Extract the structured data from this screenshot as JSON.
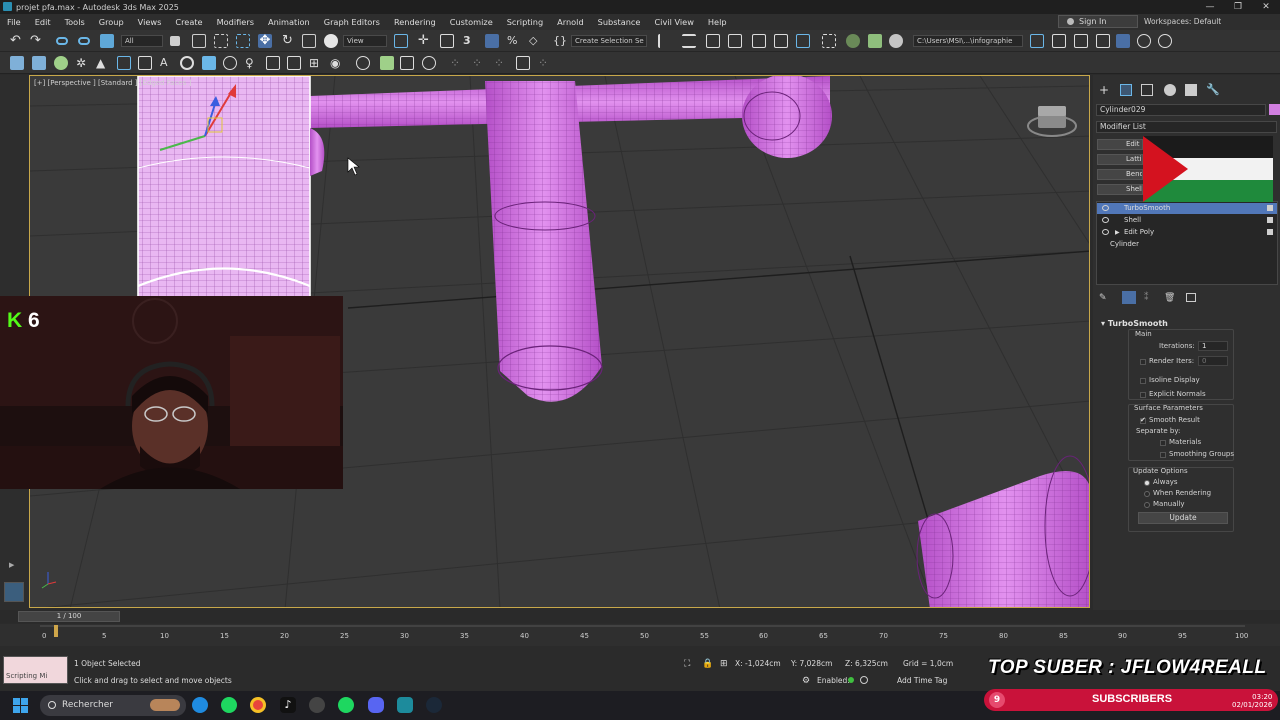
{
  "window": {
    "title": "projet pfa.max - Autodesk 3ds Max 2025",
    "controls": [
      "—",
      "❐",
      "✕"
    ]
  },
  "menubar": {
    "items": [
      "File",
      "Edit",
      "Tools",
      "Group",
      "Views",
      "Create",
      "Modifiers",
      "Animation",
      "Graph Editors",
      "Rendering",
      "Customize",
      "Scripting",
      "Arnold",
      "Substance",
      "Civil View",
      "Help"
    ],
    "sign_in": "Sign In",
    "workspaces": "Workspaces: Default"
  },
  "toolbar": {
    "selection_filter": "All",
    "ref_coord": "View",
    "named_selection": "Create Selection Se",
    "project_path": "C:\\Users\\MSI\\...\\infographie"
  },
  "viewport": {
    "label": "[+] [Perspective ] [Standard ] [Edged Faces ]"
  },
  "command_panel": {
    "object_name": "Cylinder029",
    "object_color": "#d17fe0",
    "modifier_list": "Modifier List",
    "modifier_buttons": [
      "Edit Poly",
      "Lattice",
      "Bend",
      "Shell"
    ],
    "stack": [
      {
        "label": "TurboSmooth",
        "selected": true
      },
      {
        "label": "Shell",
        "selected": false
      },
      {
        "label": "Edit Poly",
        "selected": false
      },
      {
        "label": "Cylinder",
        "selected": false
      }
    ],
    "turbosmooth": {
      "title": "TurboSmooth",
      "main": "Main",
      "iterations_label": "Iterations:",
      "iterations": "1",
      "render_iters_label": "Render Iters:",
      "render_iters": "0",
      "isoline": "Isoline Display",
      "explicit_normals": "Explicit Normals",
      "surface_params": "Surface Parameters",
      "smooth_result": "Smooth Result",
      "separate_by": "Separate by:",
      "materials": "Materials",
      "smoothing_groups": "Smoothing Groups",
      "update_options": "Update Options",
      "always": "Always",
      "when_rendering": "When Rendering",
      "manually": "Manually",
      "update": "Update"
    }
  },
  "timeline": {
    "slider": "1 / 100",
    "ticks": [
      "0",
      "5",
      "10",
      "15",
      "20",
      "25",
      "30",
      "35",
      "40",
      "45",
      "50",
      "55",
      "60",
      "65",
      "70",
      "75",
      "80",
      "85",
      "90",
      "95",
      "100"
    ]
  },
  "status": {
    "maxscript_label": "Scripting Mi",
    "selected": "1 Object Selected",
    "prompt": "Click and drag to select and move objects",
    "x": "X: -1,024cm",
    "y": "Y: 7,028cm",
    "z": "Z: 6,325cm",
    "grid": "Grid = 1,0cm",
    "enabled": "Enabled:",
    "add_time_tag": "Add Time Tag"
  },
  "overlay": {
    "kick_count": "6",
    "top_suber": "TOP SUBER : JFLOW4REALL",
    "subs_count": "9",
    "subs_label": "SUBSCRIBERS"
  },
  "taskbar": {
    "search": "Rechercher",
    "time": "03:20",
    "date": "02/01/2026"
  }
}
